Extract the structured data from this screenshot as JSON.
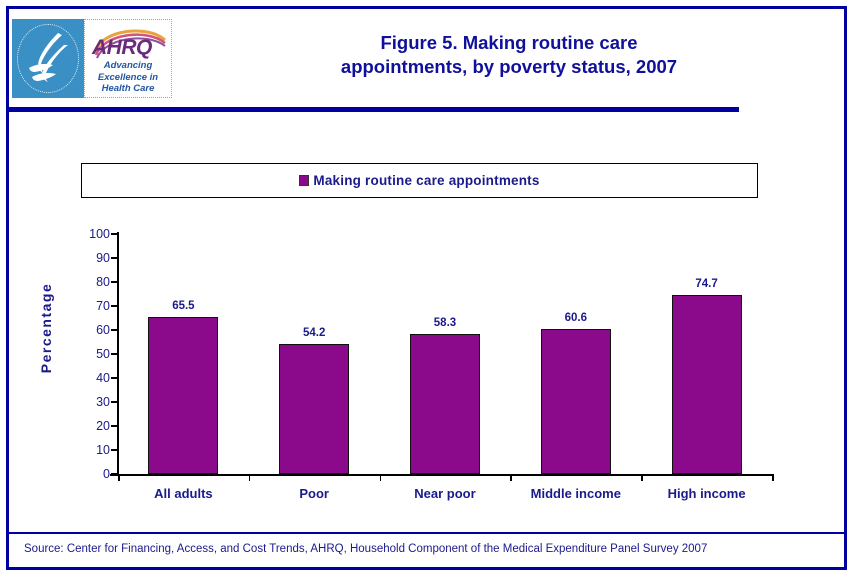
{
  "header": {
    "title_line1": "Figure 5. Making routine care",
    "title_line2": "appointments, by poverty status, 2007",
    "logo": {
      "agency_seal_name": "hhs-department-seal",
      "ahrq_wordmark": "AHRQ",
      "ahrq_tagline_line1": "Advancing",
      "ahrq_tagline_line2": "Excellence in",
      "ahrq_tagline_line3": "Health Care"
    }
  },
  "legend": {
    "entries": [
      {
        "label": "Making routine care appointments",
        "color": "#8b0a8b"
      }
    ]
  },
  "footer": {
    "source": "Source: Center for Financing, Access, and Cost Trends, AHRQ, Household Component of the Medical Expenditure Panel Survey 2007"
  },
  "colors": {
    "frame": "#0000a0",
    "title": "#10109c",
    "text": "#1a1a8c",
    "bar": "#8b0a8b",
    "seal_blue": "#3a8fc4",
    "ahrq_purple": "#6b2a7a"
  },
  "chart_data": {
    "type": "bar",
    "title": "Figure 5. Making routine care appointments, by poverty status, 2007",
    "xlabel": "",
    "ylabel": "Percentage",
    "ylim": [
      0,
      100
    ],
    "ytick_step": 10,
    "yticks": [
      100,
      90,
      80,
      70,
      60,
      50,
      40,
      30,
      20,
      10,
      0
    ],
    "grid": false,
    "legend_position": "top",
    "categories": [
      "All adults",
      "Poor",
      "Near poor",
      "Middle income",
      "High income"
    ],
    "series": [
      {
        "name": "Making routine care appointments",
        "color": "#8b0a8b",
        "values": [
          65.5,
          54.2,
          58.3,
          60.6,
          74.7
        ]
      }
    ],
    "data_labels": [
      "65.5",
      "54.2",
      "58.3",
      "60.6",
      "74.7"
    ]
  }
}
